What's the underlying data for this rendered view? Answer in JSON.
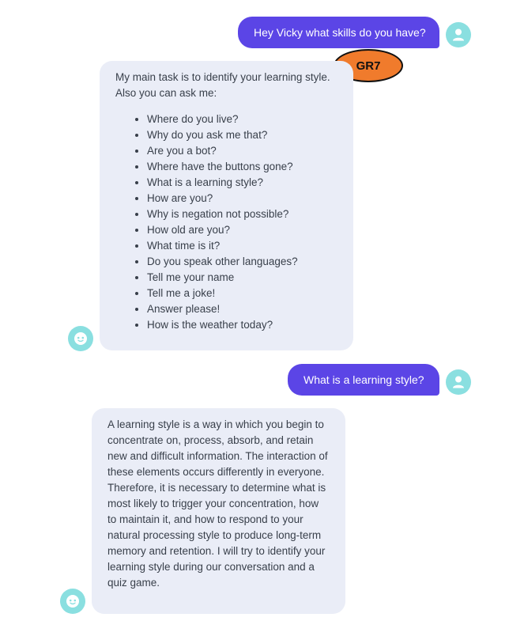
{
  "messages": {
    "user_1": "Hey Vicky what skills do you have?",
    "bot_1": {
      "intro": "My main task is to identify your learning style. Also you can ask me:",
      "suggestions": [
        "Where do you live?",
        "Why do you ask me that?",
        "Are you a bot?",
        "Where have the buttons gone?",
        "What is a learning style?",
        "How are you?",
        "Why is negation not possible?",
        "How old are you?",
        "What time is it?",
        "Do you speak other languages?",
        "Tell me your name",
        "Tell me a joke!",
        "Answer please!",
        "How is the weather today?"
      ]
    },
    "user_2": "What is a learning style?",
    "bot_2": "A learning style is a way in which you begin to concentrate on, process, absorb, and retain new and difficult information. The interaction of these elements occurs differently in everyone. Therefore, it is necessary to determine what is most likely to trigger your concentration, how to maintain it, and how to respond to your natural processing style to produce long-term memory and retention. I will try to identify your learning style during our conversation and a quiz game."
  },
  "badge": {
    "label": "GR7",
    "color": "#f07b2c"
  },
  "colors": {
    "user_bubble": "#5b45e6",
    "bot_bubble": "#eaedf7",
    "avatar": "#8adfe0"
  },
  "icons": {
    "user_avatar": "user-icon",
    "bot_avatar": "bot-face-icon"
  }
}
